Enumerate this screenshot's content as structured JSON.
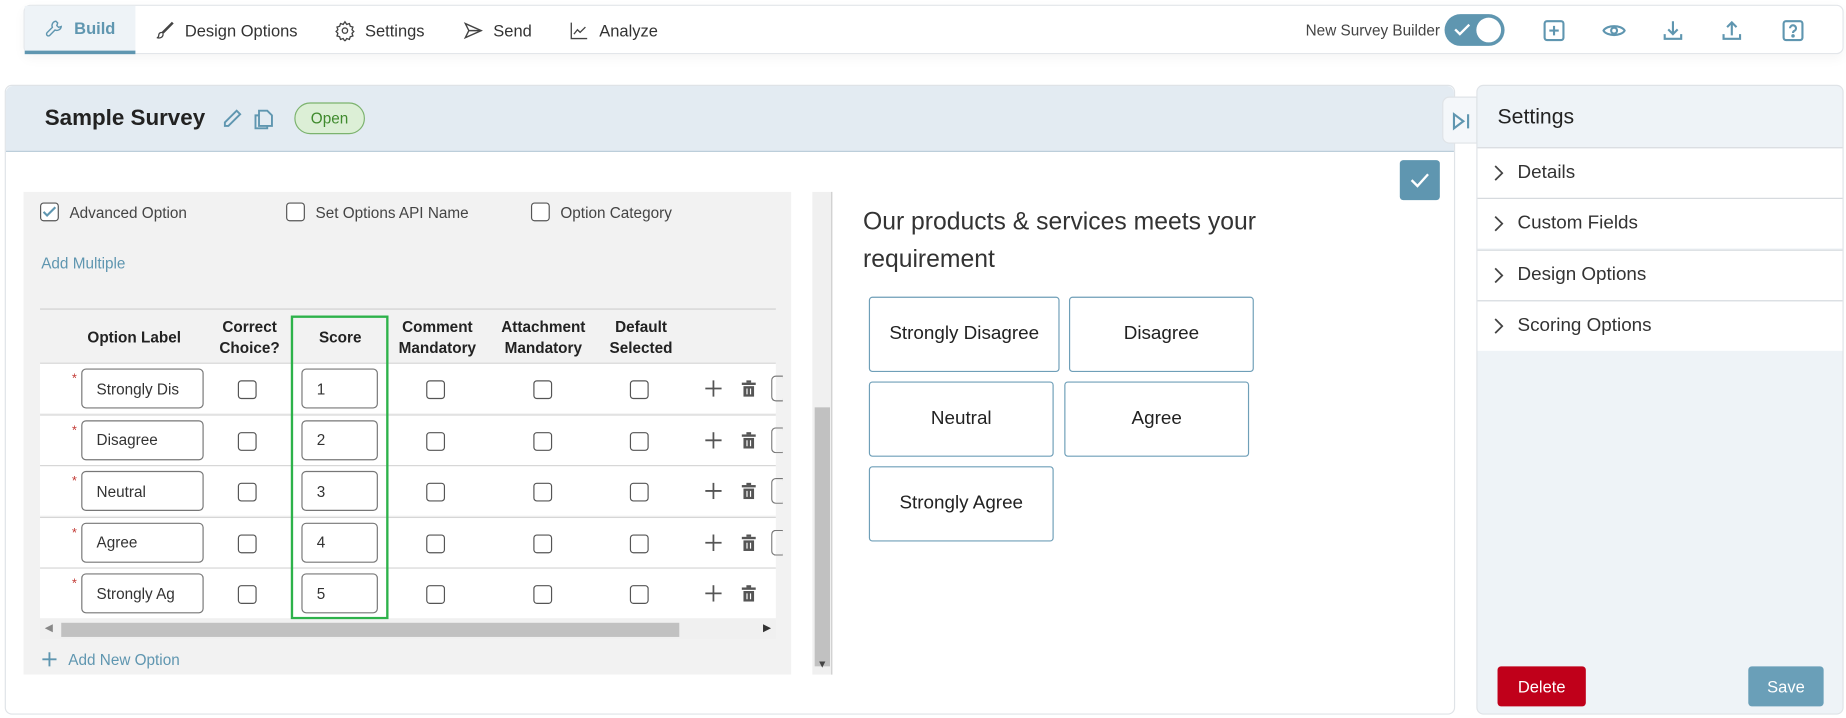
{
  "nav": {
    "tabs": [
      {
        "label": "Build",
        "icon": "wrench-icon",
        "active": true
      },
      {
        "label": "Design Options",
        "icon": "brush-icon"
      },
      {
        "label": "Settings",
        "icon": "gear-icon"
      },
      {
        "label": "Send",
        "icon": "send-icon"
      },
      {
        "label": "Analyze",
        "icon": "chart-icon"
      }
    ],
    "toggle_label": "New Survey Builder",
    "toggle_on": true,
    "toolbar_icons": [
      "add-icon",
      "eye-icon",
      "download-icon",
      "upload-icon",
      "help-icon"
    ]
  },
  "survey": {
    "title": "Sample Survey",
    "status": "Open"
  },
  "editor": {
    "checkboxes": [
      {
        "label": "Advanced Option",
        "checked": true
      },
      {
        "label": "Set Options API Name",
        "checked": false
      },
      {
        "label": "Option Category",
        "checked": false
      }
    ],
    "add_multiple": "Add Multiple",
    "columns": [
      "Option Label",
      "Correct Choice?",
      "Score",
      "Comment Mandatory",
      "Attachment Mandatory",
      "Default Selected"
    ],
    "rows": [
      {
        "label": "Strongly Dis",
        "score": "1"
      },
      {
        "label": "Disagree",
        "score": "2"
      },
      {
        "label": "Neutral",
        "score": "3"
      },
      {
        "label": "Agree",
        "score": "4"
      },
      {
        "label": "Strongly Ag",
        "score": "5"
      }
    ],
    "add_new_option": "Add New Option"
  },
  "preview": {
    "question": "Our products & services meets your requirement",
    "options": [
      "Strongly Disagree",
      "Disagree",
      "Neutral",
      "Agree",
      "Strongly Agree"
    ]
  },
  "settings_panel": {
    "title": "Settings",
    "sections": [
      "Details",
      "Custom Fields",
      "Design Options",
      "Scoring Options"
    ],
    "delete_label": "Delete",
    "save_label": "Save"
  },
  "colors": {
    "accent": "#5f96b0",
    "open_badge": "#dcefd6",
    "delete": "#c0001a",
    "highlight": "#2db24a"
  }
}
